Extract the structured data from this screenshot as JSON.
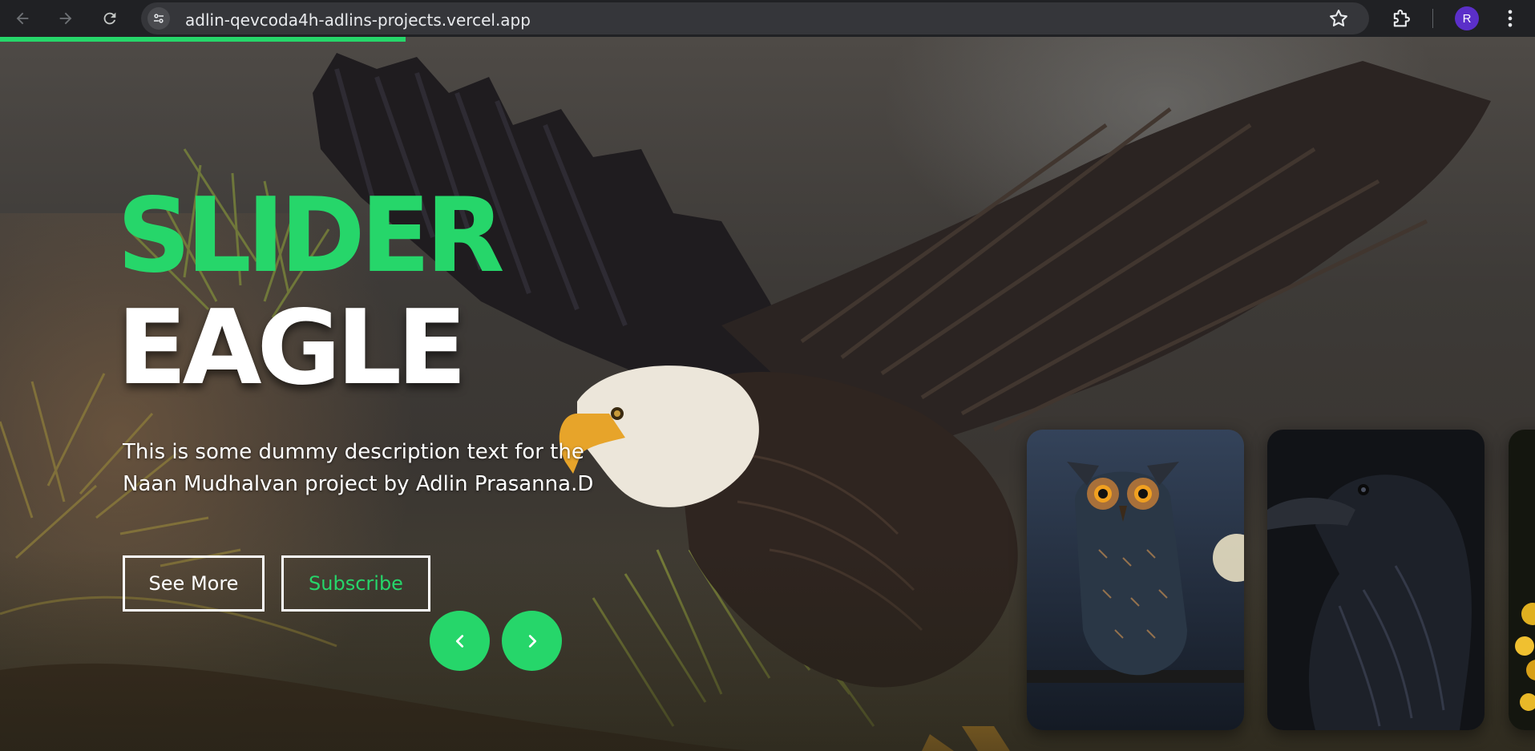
{
  "browser": {
    "url": "adlin-qevcoda4h-adlins-projects.vercel.app",
    "profile_initial": "R",
    "icons": {
      "back": "arrow-left-icon",
      "forward": "arrow-right-icon",
      "reload": "reload-icon",
      "site_info": "tune-icon",
      "bookmark": "star-icon",
      "extensions": "puzzle-icon",
      "menu": "kebab-menu-icon"
    }
  },
  "colors": {
    "accent": "#26d66a",
    "text": "#ffffff",
    "chrome_bg": "#202124",
    "omnibox_bg": "#35363a",
    "avatar_bg": "#5b2fc9"
  },
  "slider": {
    "progress_fraction": 0.264,
    "title_line_1": "SLIDER",
    "title_line_2": "EAGLE",
    "description": "This is some dummy description text for the Naan Mudhalvan project by Adlin Prasanna.D",
    "see_more_label": "See More",
    "subscribe_label": "Subscribe",
    "prev_icon": "chevron-left-icon",
    "next_icon": "chevron-right-icon",
    "background_subject": "eagle",
    "thumbnails": [
      {
        "subject": "owl"
      },
      {
        "subject": "raven"
      },
      {
        "subject": "yellow-flowers"
      }
    ]
  }
}
